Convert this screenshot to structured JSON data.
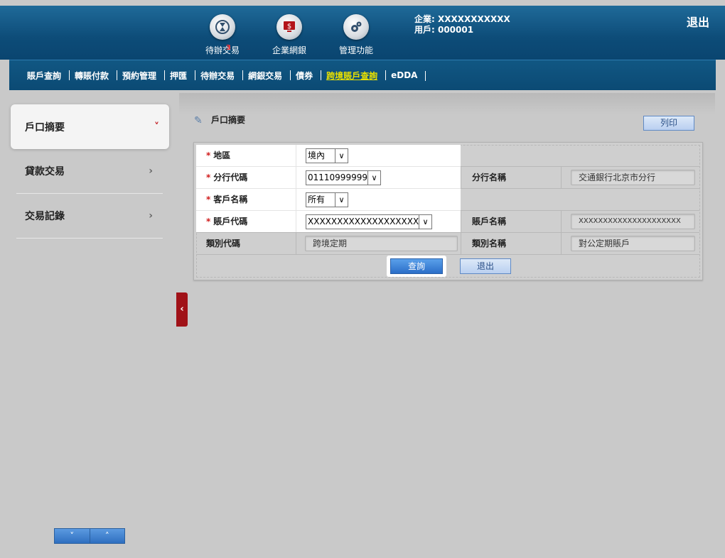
{
  "header": {
    "icons": [
      {
        "label": "待辦交易",
        "badge": "3",
        "icon": "hourglass-icon"
      },
      {
        "label": "企業網銀",
        "icon": "monitor-dollar-icon"
      },
      {
        "label": "管理功能",
        "icon": "gears-icon"
      }
    ],
    "company": "企業: XXXXXXXXXXX",
    "user": "用戶: 000001",
    "logout": "退出"
  },
  "nav": {
    "items": [
      "賬戶查詢",
      "轉賬付款",
      "預約管理",
      "押匯",
      "待辦交易",
      "網銀交易",
      "債券",
      "跨境賬戶查詢",
      "eDDA"
    ],
    "active_index": 7
  },
  "sidebar": {
    "items": [
      {
        "label": "戶口摘要",
        "chevron": "˅"
      },
      {
        "label": "貸款交易",
        "chevron": "›"
      },
      {
        "label": "交易記錄",
        "chevron": "›"
      }
    ],
    "scroll_down": "˅",
    "scroll_up": "˄",
    "collapse": "‹"
  },
  "main": {
    "title": "戶口摘要",
    "print_label": "列印",
    "form": {
      "region_label": "地區",
      "region_value": "境內",
      "branch_code_label": "分行代碼",
      "branch_code_value": "01110999999",
      "branch_name_label": "分行名稱",
      "branch_name_value": "交通銀行北京市分行",
      "customer_name_label": "客戶名稱",
      "customer_name_value": "所有",
      "account_code_label": "賬戶代碼",
      "account_code_value": "XXXXXXXXXXXXXXXXXXXXX",
      "account_name_label": "賬戶名稱",
      "account_name_value": "XXXXXXXXXXXXXXXXXXXXX",
      "category_code_label": "類別代碼",
      "category_code_value": "跨境定期",
      "category_name_label": "類別名稱",
      "category_name_value": "對公定期賬戶",
      "required_mark": "*"
    },
    "query_label": "查詢",
    "exit_label": "退出"
  }
}
